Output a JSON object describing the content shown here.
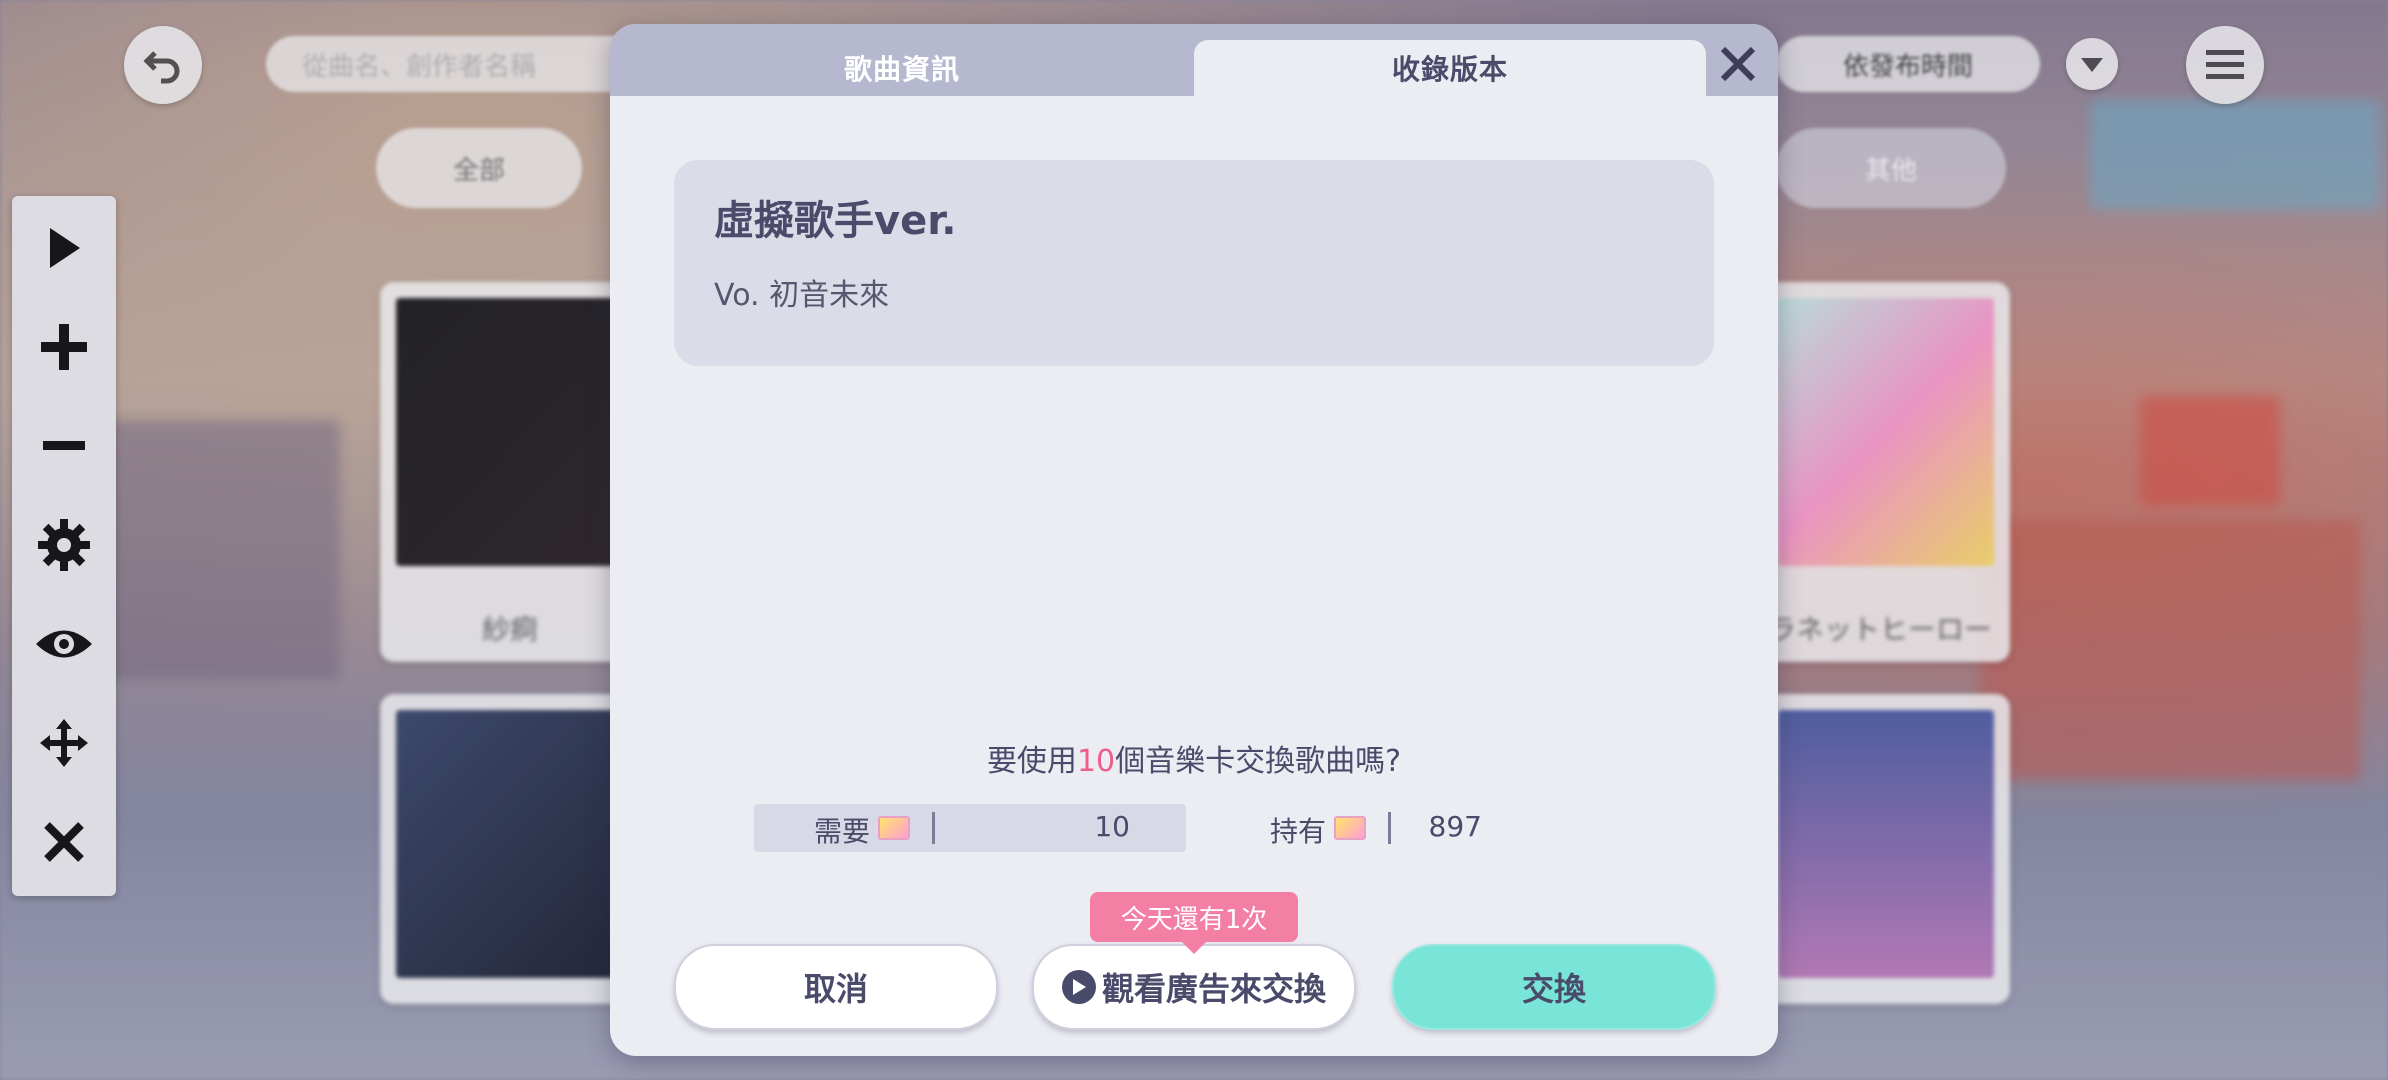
{
  "background": {
    "search_placeholder": "從曲名、創作者名稱",
    "sort_label": "依發布時間",
    "filter_all": "全部",
    "filter_other": "其他",
    "cards": [
      {
        "caption": "紗痾"
      },
      {
        "caption": "ラネットヒーロー"
      },
      {
        "caption": ""
      },
      {
        "caption": ""
      }
    ]
  },
  "toolbar": {
    "items": [
      "play-icon",
      "plus-icon",
      "minus-icon",
      "gear-icon",
      "eye-icon",
      "move-icon",
      "close-icon"
    ]
  },
  "dialog": {
    "tabs": [
      {
        "label": "歌曲資訊",
        "active": false
      },
      {
        "label": "收錄版本",
        "active": true
      }
    ],
    "version": {
      "title": "虛擬歌手ver.",
      "vocal": "Vo. 初音未來"
    },
    "question": {
      "prefix": "要使用",
      "amount": "10",
      "suffix": "個音樂卡交換歌曲嗎?"
    },
    "need": {
      "label": "需要",
      "value": "10"
    },
    "have": {
      "label": "持有",
      "value": "897"
    },
    "badge": "今天還有1次",
    "buttons": {
      "cancel": "取消",
      "watch_ad": "觀看廣告來交換",
      "exchange": "交換"
    }
  },
  "colors": {
    "accent_pink": "#ef5d8a",
    "exchange_teal": "#79e5d8",
    "badge_pink": "#f47fa4",
    "text_dark": "#4a4a6a"
  }
}
